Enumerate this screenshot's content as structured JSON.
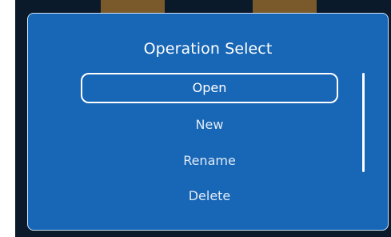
{
  "dialog": {
    "title": "Operation Select",
    "options": [
      {
        "label": "Open",
        "selected": true
      },
      {
        "label": "New",
        "selected": false
      },
      {
        "label": "Rename",
        "selected": false
      },
      {
        "label": "Delete",
        "selected": false
      }
    ]
  },
  "colors": {
    "dialog_background": "#1866b6",
    "dialog_border": "#cfe3f7",
    "screen_background": "#0a1a2b",
    "text": "#ffffff"
  },
  "icons": {
    "scrollbar": "vertical-scrollbar"
  }
}
